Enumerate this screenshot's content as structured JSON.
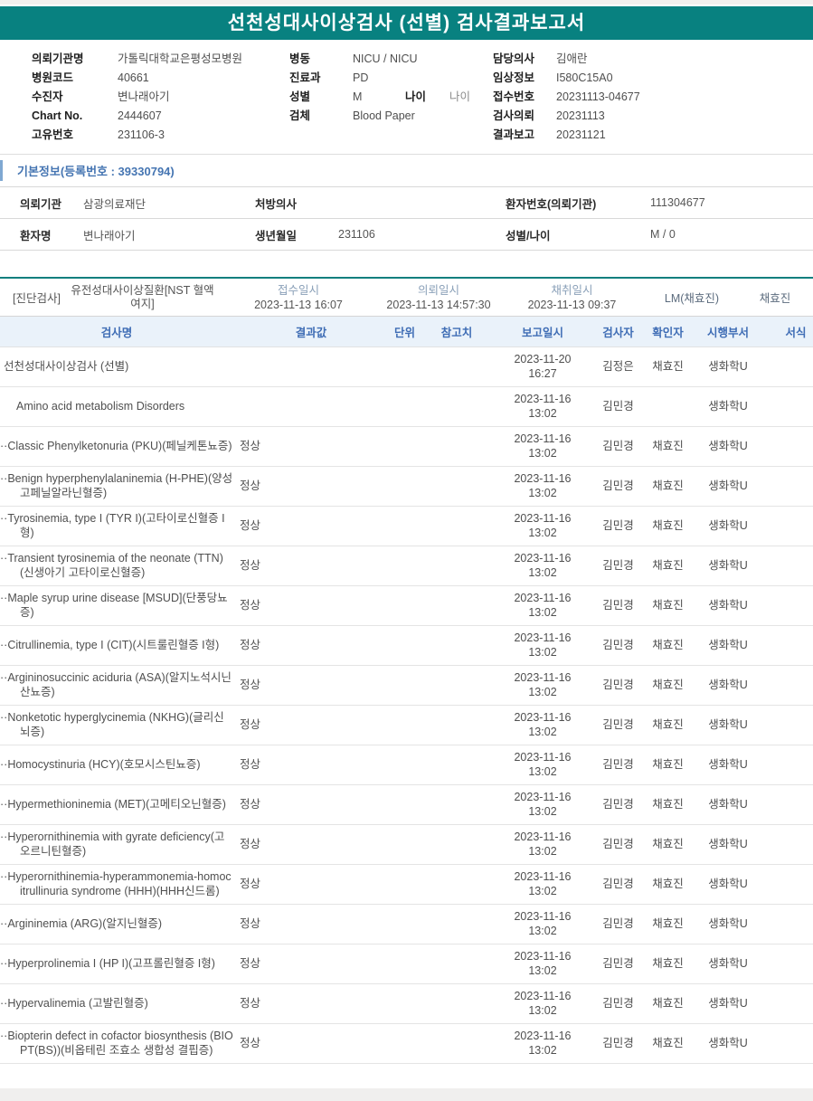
{
  "title": "선천성대사이상검사 (선별) 검사결과보고서",
  "colors": {
    "header_teal": "#088180",
    "heading_blue": "#4575b2",
    "table_header_bg": "#eaf2fa",
    "table_header_text": "#3f6db5"
  },
  "patient_info": {
    "left": [
      {
        "label": "의뢰기관명",
        "value": "가톨릭대학교은평성모병원"
      },
      {
        "label": "병원코드",
        "value": "40661"
      },
      {
        "label": "수진자",
        "value": "변나래아기"
      },
      {
        "label": "Chart No.",
        "value": "2444607"
      },
      {
        "label": "고유번호",
        "value": "231106-3"
      }
    ],
    "middle": [
      {
        "label": "병동",
        "value": "NICU / NICU"
      },
      {
        "label": "진료과",
        "value": "PD"
      },
      {
        "label": "성별",
        "value": "M",
        "label2": "나이",
        "value2": "나이"
      },
      {
        "label": "검체",
        "value": "Blood Paper"
      }
    ],
    "right": [
      {
        "label": "담당의사",
        "value": "김애란"
      },
      {
        "label": "임상정보",
        "value": "I580C15A0"
      },
      {
        "label": "접수번호",
        "value": "20231113-04677"
      },
      {
        "label": "검사의뢰",
        "value": "20231113"
      },
      {
        "label": "결과보고",
        "value": "20231121"
      }
    ]
  },
  "basic_info": {
    "heading": "기본정보(등록번호 : 39330794)",
    "rows": [
      [
        {
          "label": "의뢰기관",
          "value": "삼광의료재단"
        },
        {
          "label": "처방의사",
          "value": ""
        },
        {
          "label": "환자번호(의뢰기관)",
          "value": "111304677"
        }
      ],
      [
        {
          "label": "환자명",
          "value": "변나래아기"
        },
        {
          "label": "생년월일",
          "value": "231106"
        },
        {
          "label": "성별/나이",
          "value": "M / 0"
        }
      ]
    ]
  },
  "diagnosis_bar": {
    "tag": "[진단검사]",
    "test_name": "유전성대사이상질환[NST 혈액여지]",
    "columns": [
      {
        "label": "접수일시",
        "value": "2023-11-13 16:07"
      },
      {
        "label": "의뢰일시",
        "value": "2023-11-13 14:57:30"
      },
      {
        "label": "채취일시",
        "value": "2023-11-13 09:37"
      }
    ],
    "lm": "LM(채효진)",
    "collector": "채효진"
  },
  "results_table": {
    "headers": [
      "검사명",
      "결과값",
      "단위",
      "참고치",
      "보고일시",
      "검사자",
      "확인자",
      "시행부서",
      "서식"
    ],
    "rows": [
      {
        "name": "선천성대사이상검사 (선별)",
        "level": 0,
        "result": "",
        "unit": "",
        "ref": "",
        "reported": "2023-11-20 16:27",
        "tester": "김정은",
        "confirmer": "채효진",
        "dept": "생화학U",
        "form": ""
      },
      {
        "name": "Amino acid metabolism Disorders",
        "level": 1,
        "result": "",
        "unit": "",
        "ref": "",
        "reported": "2023-11-16 13:02",
        "tester": "김민경",
        "confirmer": "",
        "dept": "생화학U",
        "form": ""
      },
      {
        "name": "··Classic Phenylketonuria (PKU)(페닐케톤뇨증)",
        "level": 2,
        "result": "정상",
        "unit": "",
        "ref": "",
        "reported": "2023-11-16 13:02",
        "tester": "김민경",
        "confirmer": "채효진",
        "dept": "생화학U",
        "form": ""
      },
      {
        "name": "··Benign hyperphenylalaninemia (H-PHE)(양성 고페닐알라닌혈증)",
        "level": 2,
        "result": "정상",
        "unit": "",
        "ref": "",
        "reported": "2023-11-16 13:02",
        "tester": "김민경",
        "confirmer": "채효진",
        "dept": "생화학U",
        "form": ""
      },
      {
        "name": "··Tyrosinemia, type I (TYR I)(고타이로신혈증 I형)",
        "level": 2,
        "result": "정상",
        "unit": "",
        "ref": "",
        "reported": "2023-11-16 13:02",
        "tester": "김민경",
        "confirmer": "채효진",
        "dept": "생화학U",
        "form": ""
      },
      {
        "name": "··Transient tyrosinemia of the neonate (TTN)(신생아기 고타이로신혈증)",
        "level": 2,
        "result": "정상",
        "unit": "",
        "ref": "",
        "reported": "2023-11-16 13:02",
        "tester": "김민경",
        "confirmer": "채효진",
        "dept": "생화학U",
        "form": ""
      },
      {
        "name": "··Maple syrup urine disease [MSUD](단풍당뇨증)",
        "level": 2,
        "result": "정상",
        "unit": "",
        "ref": "",
        "reported": "2023-11-16 13:02",
        "tester": "김민경",
        "confirmer": "채효진",
        "dept": "생화학U",
        "form": ""
      },
      {
        "name": "··Citrullinemia, type I (CIT)(시트룰린혈증 I형)",
        "level": 2,
        "result": "정상",
        "unit": "",
        "ref": "",
        "reported": "2023-11-16 13:02",
        "tester": "김민경",
        "confirmer": "채효진",
        "dept": "생화학U",
        "form": ""
      },
      {
        "name": "··Argininosuccinic aciduria (ASA)(알지노석시닌산뇨증)",
        "level": 2,
        "result": "정상",
        "unit": "",
        "ref": "",
        "reported": "2023-11-16 13:02",
        "tester": "김민경",
        "confirmer": "채효진",
        "dept": "생화학U",
        "form": ""
      },
      {
        "name": "··Nonketotic hyperglycinemia (NKHG)(글리신뇌증)",
        "level": 2,
        "result": "정상",
        "unit": "",
        "ref": "",
        "reported": "2023-11-16 13:02",
        "tester": "김민경",
        "confirmer": "채효진",
        "dept": "생화학U",
        "form": ""
      },
      {
        "name": "··Homocystinuria (HCY)(호모시스틴뇨증)",
        "level": 2,
        "result": "정상",
        "unit": "",
        "ref": "",
        "reported": "2023-11-16 13:02",
        "tester": "김민경",
        "confirmer": "채효진",
        "dept": "생화학U",
        "form": ""
      },
      {
        "name": "··Hypermethioninemia (MET)(고메티오닌혈증)",
        "level": 2,
        "result": "정상",
        "unit": "",
        "ref": "",
        "reported": "2023-11-16 13:02",
        "tester": "김민경",
        "confirmer": "채효진",
        "dept": "생화학U",
        "form": ""
      },
      {
        "name": "··Hyperornithinemia with gyrate deficiency(고오르니틴혈증)",
        "level": 2,
        "result": "정상",
        "unit": "",
        "ref": "",
        "reported": "2023-11-16 13:02",
        "tester": "김민경",
        "confirmer": "채효진",
        "dept": "생화학U",
        "form": ""
      },
      {
        "name": "··Hyperornithinemia-hyperammonemia-homocitrullinuria syndrome (HHH)(HHH신드롬)",
        "level": 2,
        "result": "정상",
        "unit": "",
        "ref": "",
        "reported": "2023-11-16 13:02",
        "tester": "김민경",
        "confirmer": "채효진",
        "dept": "생화학U",
        "form": ""
      },
      {
        "name": "··Argininemia (ARG)(알지닌혈증)",
        "level": 2,
        "result": "정상",
        "unit": "",
        "ref": "",
        "reported": "2023-11-16 13:02",
        "tester": "김민경",
        "confirmer": "채효진",
        "dept": "생화학U",
        "form": ""
      },
      {
        "name": "··Hyperprolinemia I (HP I)(고프롤린혈증 I형)",
        "level": 2,
        "result": "정상",
        "unit": "",
        "ref": "",
        "reported": "2023-11-16 13:02",
        "tester": "김민경",
        "confirmer": "채효진",
        "dept": "생화학U",
        "form": ""
      },
      {
        "name": "··Hypervalinemia (고발린혈증)",
        "level": 2,
        "result": "정상",
        "unit": "",
        "ref": "",
        "reported": "2023-11-16 13:02",
        "tester": "김민경",
        "confirmer": "채효진",
        "dept": "생화학U",
        "form": ""
      },
      {
        "name": "··Biopterin defect in cofactor biosynthesis (BIOPT(BS))(비옵테린 조효소 생합성 결핍증)",
        "level": 2,
        "result": "정상",
        "unit": "",
        "ref": "",
        "reported": "2023-11-16 13:02",
        "tester": "김민경",
        "confirmer": "채효진",
        "dept": "생화학U",
        "form": ""
      }
    ]
  }
}
